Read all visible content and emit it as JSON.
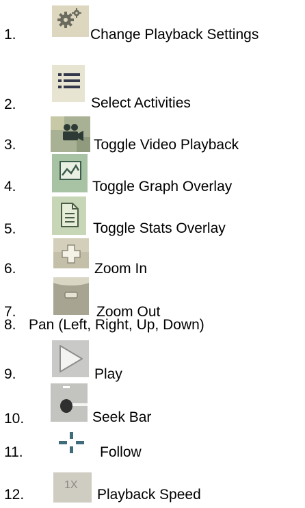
{
  "legend": [
    {
      "number": "1.",
      "label": "Change Playback Settings",
      "icon": "gear-icon"
    },
    {
      "number": "2.",
      "label": "Select Activities",
      "icon": "list-icon"
    },
    {
      "number": "3.",
      "label": "Toggle Video Playback",
      "icon": "video-camera-icon"
    },
    {
      "number": "4.",
      "label": "Toggle Graph Overlay",
      "icon": "graph-icon"
    },
    {
      "number": "5.",
      "label": "Toggle Stats Overlay",
      "icon": "document-icon"
    },
    {
      "number": "6.",
      "label": "Zoom In",
      "icon": "zoom-in-icon"
    },
    {
      "number": "7.",
      "label": "Zoom Out",
      "icon": "zoom-out-icon"
    },
    {
      "number": "8.",
      "label": "Pan (Left, Right, Up, Down)",
      "icon": ""
    },
    {
      "number": "9.",
      "label": "Play",
      "icon": "play-icon"
    },
    {
      "number": "10.",
      "label": "Seek Bar",
      "icon": "seek-bar-icon"
    },
    {
      "number": "11.",
      "label": "Follow",
      "icon": "crosshair-icon"
    },
    {
      "number": "12.",
      "label": "Playback Speed",
      "icon": "speed-icon",
      "icon_text": "1X"
    }
  ]
}
